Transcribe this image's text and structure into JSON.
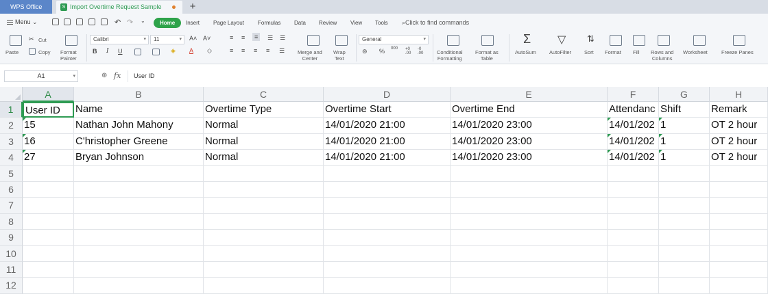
{
  "window": {
    "app_tab": "WPS Office",
    "doc_tab": "Import Overtime Request Sample",
    "doc_icon": "S",
    "new_tab": "+"
  },
  "menubar": {
    "menu_label": "Menu",
    "tabs": [
      "Home",
      "Insert",
      "Page Layout",
      "Formulas",
      "Data",
      "Review",
      "View",
      "Tools"
    ],
    "active_tab": "Home",
    "search_placeholder": "Click to find commands"
  },
  "ribbon": {
    "paste": "Paste",
    "cut": "Cut",
    "copy": "Copy",
    "format_painter": "Format\nPainter",
    "font_name": "Calibri",
    "font_size": "11",
    "bold": "B",
    "italic": "I",
    "underline": "U",
    "merge_center": "Merge and\nCenter",
    "wrap_text": "Wrap\nText",
    "number_format": "General",
    "percent": "%",
    "thousands": "000",
    "conditional_formatting": "Conditional\nFormatting",
    "format_as_table": "Format as\nTable",
    "autosum": "AutoSum",
    "autofilter": "AutoFilter",
    "sort": "Sort",
    "format": "Format",
    "fill": "Fill",
    "rows_columns": "Rows and\nColumns",
    "worksheet": "Worksheet",
    "freeze_panes": "Freeze Panes"
  },
  "formula_bar": {
    "name_box": "A1",
    "fx": "fx",
    "content": "User ID"
  },
  "sheet": {
    "columns": [
      "A",
      "B",
      "C",
      "D",
      "E",
      "F",
      "G",
      "H"
    ],
    "row_numbers": [
      "1",
      "2",
      "3",
      "4",
      "5",
      "6",
      "7",
      "8",
      "9",
      "10",
      "11",
      "12"
    ],
    "selected_cell": "A1",
    "rows": [
      [
        "User ID",
        "Name",
        "Overtime Type",
        "Overtime Start",
        "Overtime End",
        "Attendanc",
        "Shift",
        "Remark"
      ],
      [
        "15",
        "Nathan John Mahony",
        "Normal",
        "14/01/2020 21:00",
        "14/01/2020 23:00",
        "14/01/202",
        "1",
        "OT 2 hour"
      ],
      [
        "16",
        "C'hristopher Greene",
        "Normal",
        "14/01/2020 21:00",
        "14/01/2020 23:00",
        "14/01/202",
        "1",
        "OT 2 hour"
      ],
      [
        "27",
        "Bryan Johnson",
        "Normal",
        "14/01/2020 21:00",
        "14/01/2020 23:00",
        "14/01/202",
        "1",
        "OT 2 hour"
      ]
    ]
  },
  "colors": {
    "accent": "#2e9b53",
    "app_tab": "#5b86c9"
  }
}
